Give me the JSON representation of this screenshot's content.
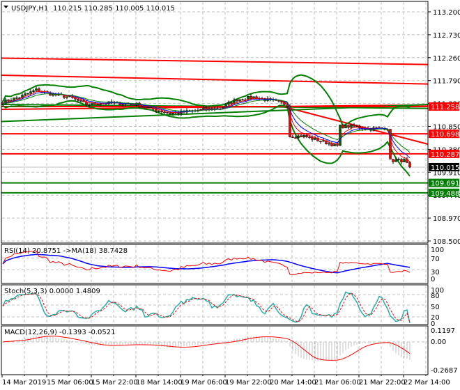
{
  "header": {
    "symbol": "USDJPY,H1",
    "ohlc": "110.215 110.285 110.005 110.015"
  },
  "colors": {
    "bull_body": "#006400",
    "bear_body": "#ff0000",
    "bollinger": "#008000",
    "level_red": "#ff0000",
    "level_green": "#008000",
    "current_price": "#000000",
    "rsi": "#ff0000",
    "rsi_ma": "#0000ff",
    "stoch_main": "#20b2aa",
    "stoch_signal": "#ff0000",
    "macd_hist": "#c0c0c0",
    "macd_signal": "#ff0000"
  },
  "chart_data": {
    "type": "candlestick",
    "symbol": "USDJPY",
    "timeframe": "H1",
    "price_ticks": [
      "113.200",
      "112.730",
      "112.260",
      "111.790",
      "111.320",
      "110.850",
      "110.380",
      "109.910",
      "109.440",
      "108.970",
      "108.500"
    ],
    "ylim": [
      108.5,
      113.2
    ],
    "time_ticks": [
      "14 Mar 2019",
      "15 Mar 06:00",
      "15 Mar 22:00",
      "18 Mar 14:00",
      "19 Mar 06:00",
      "19 Mar 22:00",
      "20 Mar 14:00",
      "21 Mar 06:00",
      "21 Mar 22:00",
      "22 Mar 14:00"
    ],
    "closes_every_6h": [
      111.35,
      111.45,
      111.6,
      111.5,
      111.45,
      111.3,
      111.33,
      111.32,
      111.3,
      111.2,
      111.12,
      111.15,
      111.2,
      111.22,
      111.4,
      111.45,
      111.38,
      111.3,
      110.65,
      110.55,
      110.45,
      110.85,
      110.8,
      110.82,
      110.15
    ],
    "last_close": 110.015,
    "price_tags": [
      {
        "label": "111.258",
        "value": 111.258,
        "color": "red"
      },
      {
        "label": "110.698",
        "value": 110.698,
        "color": "red"
      },
      {
        "label": "110.287",
        "value": 110.287,
        "color": "red"
      },
      {
        "label": "110.015",
        "value": 110.015,
        "color": "black"
      },
      {
        "label": "109.691",
        "value": 109.691,
        "color": "green"
      },
      {
        "label": "109.488",
        "value": 109.488,
        "color": "green"
      }
    ],
    "sloped_red_lines": [
      [
        112.25,
        112.12
      ],
      [
        111.9,
        111.72
      ]
    ],
    "trend_line": [
      111.28,
      110.28
    ],
    "indicators": {
      "rsi": {
        "label": "RSI(14) 20.8751  ->MA(18) 38.7428",
        "ticks": [
          "100",
          "70",
          "30",
          "0"
        ]
      },
      "stoch": {
        "label": "Stoch(5,3,3) 0.0000 1.4809",
        "ticks": [
          "100",
          "80",
          "50",
          "20",
          "0"
        ]
      },
      "macd": {
        "label": "MACD(12,26,9) -0.1393 -0.0521",
        "ticks": [
          "0.1197",
          "0.00",
          "-0.2687"
        ]
      }
    }
  }
}
